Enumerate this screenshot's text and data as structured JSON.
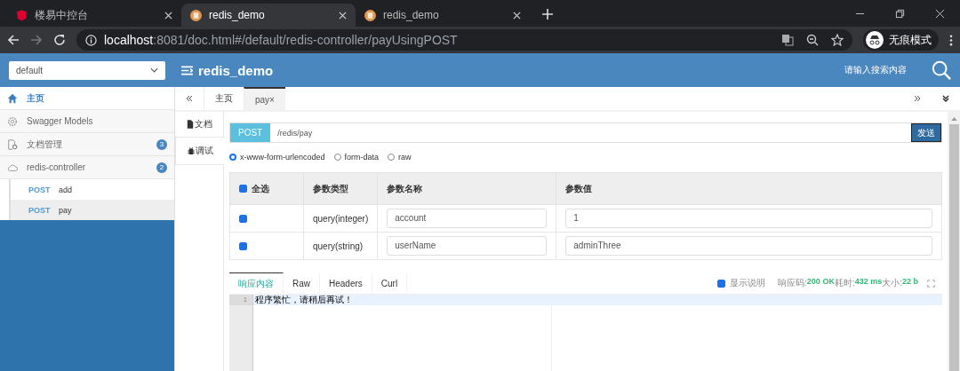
{
  "browser": {
    "tabs": [
      {
        "title": "楼易中控台",
        "selected": false,
        "kind": "shield"
      },
      {
        "title": "redis_demo",
        "selected": true,
        "kind": "page"
      },
      {
        "title": "redis_demo",
        "selected": false,
        "kind": "page"
      }
    ],
    "address": {
      "host": "localhost",
      "path": ":8081/doc.html#/default/redis-controller/payUsingPOST"
    },
    "incognito": "无痕模式"
  },
  "header": {
    "group": "default",
    "title": "redis_demo",
    "search_placeholder": "请输入搜索内容"
  },
  "sidebar": {
    "items": [
      {
        "label": "主页",
        "kind": "home",
        "selected": true
      },
      {
        "label": "Swagger Models",
        "kind": "models",
        "selected": false
      },
      {
        "label": "文档管理",
        "kind": "docs",
        "badge": "3",
        "selected": false
      },
      {
        "label": "redis-controller",
        "kind": "cloud",
        "badge": "2",
        "selected": false,
        "children": [
          {
            "method": "POST",
            "name": "add",
            "selected": false
          },
          {
            "method": "POST",
            "name": "pay",
            "selected": true
          }
        ]
      }
    ]
  },
  "doc_tabs": [
    {
      "label": "主页",
      "selected": false
    },
    {
      "label": "pay×",
      "selected": true
    }
  ],
  "side_tabs": [
    {
      "label": "文档",
      "kind": "doc",
      "selected": false
    },
    {
      "label": "调试",
      "kind": "debug",
      "selected": true
    }
  ],
  "request": {
    "method": "POST",
    "url": "/redis/pay",
    "send": "发送"
  },
  "body_types": [
    {
      "label": "x-www-form-urlencoded",
      "selected": true
    },
    {
      "label": "form-data",
      "selected": false
    },
    {
      "label": "raw",
      "selected": false
    }
  ],
  "params": {
    "select_all": {
      "label": "全选",
      "checked": true
    },
    "columns": [
      "参数类型",
      "参数名称",
      "参数值"
    ],
    "rows": [
      {
        "checked": true,
        "type": "query(integer)",
        "name": "account",
        "value": "1"
      },
      {
        "checked": true,
        "type": "query(string)",
        "name": "userName",
        "value": "adminThree"
      }
    ]
  },
  "response": {
    "tabs": [
      {
        "label": "响应内容",
        "selected": true
      },
      {
        "label": "Raw",
        "selected": false
      },
      {
        "label": "Headers",
        "selected": false
      },
      {
        "label": "Curl",
        "selected": false
      }
    ],
    "show_desc": {
      "label": "显示说明",
      "checked": true
    },
    "meta": [
      {
        "label": "响应码:",
        "value": "200 OK"
      },
      {
        "label": "耗时:",
        "value": "432 ms"
      },
      {
        "label": "大小:",
        "value": "22 b"
      }
    ],
    "lines": [
      {
        "number": "1",
        "text": "程序繁忙，请稍后再试！"
      }
    ]
  }
}
